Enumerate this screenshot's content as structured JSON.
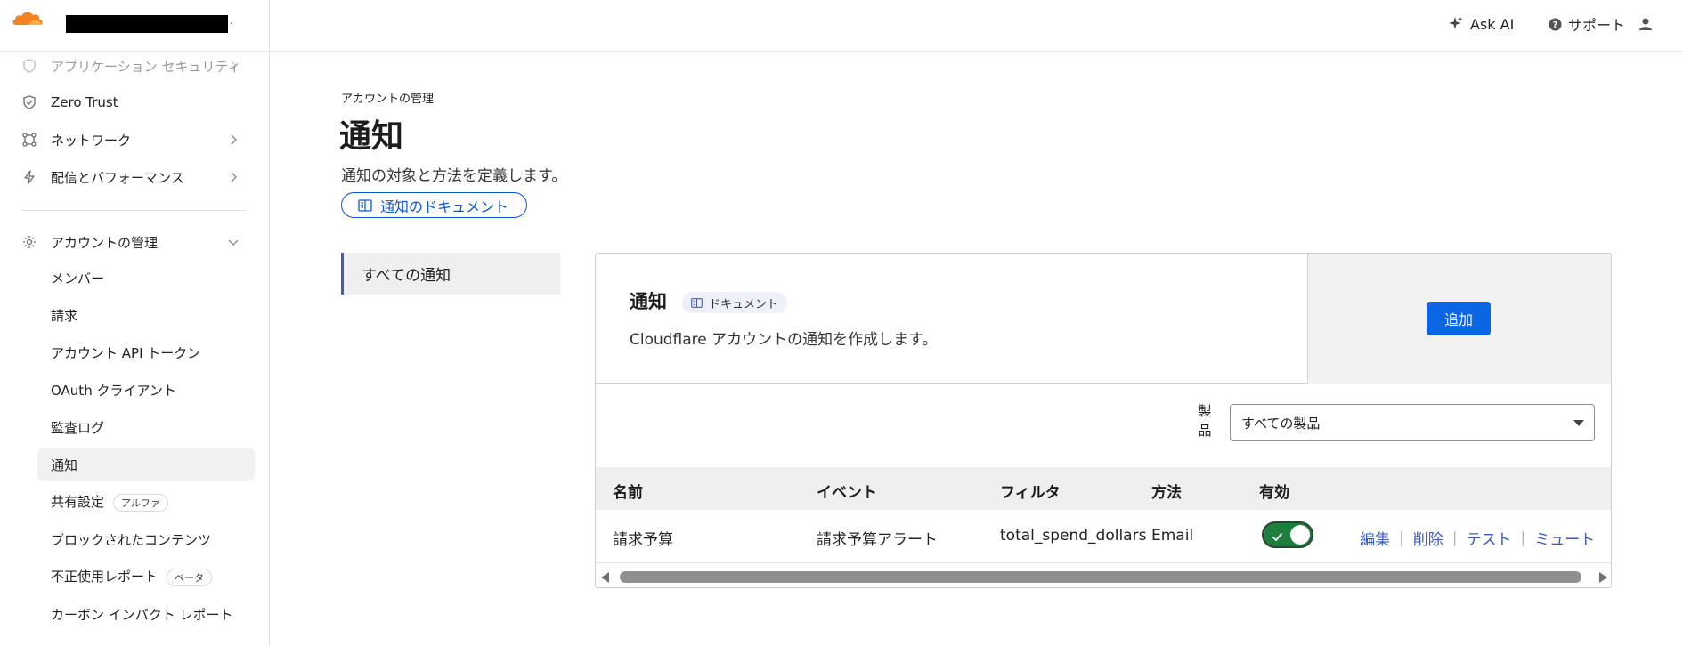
{
  "brand": {
    "logo_icon": "cloudflare-cloud-logo",
    "account_name": "",
    "accent_color": "#f6821f"
  },
  "sidebar": {
    "items": [
      {
        "label": "アプリケーション セキュリティ",
        "icon": "shield-icon"
      },
      {
        "label": "Zero Trust",
        "icon": "zero-trust-icon"
      },
      {
        "label": "ネットワーク",
        "icon": "network-icon"
      },
      {
        "label": "配信とパフォーマンス",
        "icon": "bolt-icon"
      },
      {
        "label": "アカウントの管理",
        "icon": "gear-icon"
      }
    ],
    "sub_items": [
      {
        "label": "メンバー"
      },
      {
        "label": "請求"
      },
      {
        "label": "アカウント API トークン"
      },
      {
        "label": "OAuth クライアント"
      },
      {
        "label": "監査ログ"
      },
      {
        "label": "通知"
      },
      {
        "label": "共有設定",
        "badge": "アルファ"
      },
      {
        "label": "ブロックされたコンテンツ"
      },
      {
        "label": "不正使用レポート",
        "badge": "ベータ"
      },
      {
        "label": "カーボン インパクト レポート"
      }
    ]
  },
  "topbar": {
    "ask_ai": "Ask AI",
    "support": "サポート"
  },
  "page": {
    "breadcrumb": "アカウントの管理",
    "title": "通知",
    "description": "通知の対象と方法を定義します。",
    "doc_link": "通知のドキュメント",
    "subnav_item": "すべての通知"
  },
  "card": {
    "title": "通知",
    "doc_badge": "ドキュメント",
    "description": "Cloudflare アカウントの通知を作成します。",
    "add_button": "追加",
    "filter_label": "製品",
    "filter_value": "すべての製品",
    "columns": [
      "名前",
      "イベント",
      "フィルタ",
      "方法",
      "有効"
    ],
    "rows": [
      {
        "name": "請求予算",
        "event": "請求予算アラート",
        "filter": "total_spend_dollars",
        "method": "Email",
        "enabled": true
      }
    ],
    "actions": [
      "編集",
      "削除",
      "テスト",
      "ミュート"
    ],
    "toggle_color": "#1e7e3e",
    "primary_color": "#0b66e4",
    "link_color": "#3b5bb8"
  }
}
